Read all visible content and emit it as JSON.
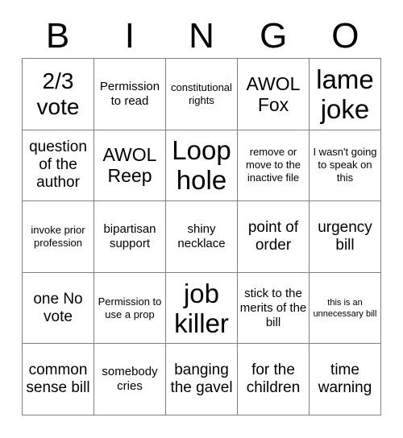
{
  "card": {
    "title": "BINGO",
    "header_letters": [
      "B",
      "I",
      "N",
      "G",
      "O"
    ],
    "colors": {
      "text": "#000000",
      "background": "#ffffff",
      "grid_line": "#808080"
    },
    "rows": [
      [
        {
          "text": "2/3 vote",
          "size": "xl"
        },
        {
          "text": "Permission to read",
          "size": "sm"
        },
        {
          "text": "constitutional rights",
          "size": "xs"
        },
        {
          "text": "AWOL Fox",
          "size": "lg"
        },
        {
          "text": "lame joke",
          "size": "xxl"
        }
      ],
      [
        {
          "text": "question of the author",
          "size": "md"
        },
        {
          "text": "AWOL Reep",
          "size": "lg"
        },
        {
          "text": "Loop hole",
          "size": "xxl"
        },
        {
          "text": "remove or move to the inactive file",
          "size": "xs"
        },
        {
          "text": "I wasn't going to speak on this",
          "size": "xs"
        }
      ],
      [
        {
          "text": "invoke prior profession",
          "size": "xs"
        },
        {
          "text": "bipartisan support",
          "size": "sm"
        },
        {
          "text": "shiny necklace",
          "size": "sm"
        },
        {
          "text": "point of order",
          "size": "md"
        },
        {
          "text": "urgency bill",
          "size": "md"
        }
      ],
      [
        {
          "text": "one No vote",
          "size": "md"
        },
        {
          "text": "Permission to use a prop",
          "size": "xs"
        },
        {
          "text": "job killer",
          "size": "xxl"
        },
        {
          "text": "stick to the merits of the bill",
          "size": "sm"
        },
        {
          "text": "this is an unnecessary bill",
          "size": "xxs"
        }
      ],
      [
        {
          "text": "common sense bill",
          "size": "md"
        },
        {
          "text": "somebody cries",
          "size": "sm"
        },
        {
          "text": "banging the gavel",
          "size": "md"
        },
        {
          "text": "for the children",
          "size": "md"
        },
        {
          "text": "time warning",
          "size": "md"
        }
      ]
    ]
  }
}
